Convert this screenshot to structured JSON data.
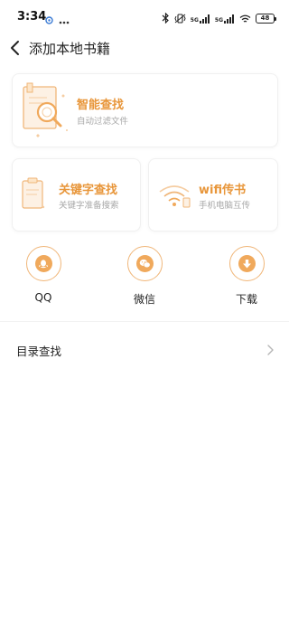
{
  "status_bar": {
    "time": "3:34",
    "network_1": "5G",
    "network_2": "5G",
    "battery": "48"
  },
  "header": {
    "title": "添加本地书籍"
  },
  "cards": {
    "smart": {
      "title": "智能查找",
      "subtitle": "自动过滤文件"
    },
    "keyword": {
      "title": "关键字查找",
      "subtitle": "关键字准备搜索"
    },
    "wifi": {
      "title": "wifi传书",
      "subtitle": "手机电脑互传"
    }
  },
  "sources": [
    {
      "label": "QQ",
      "icon": "qq-icon"
    },
    {
      "label": "微信",
      "icon": "wechat-icon"
    },
    {
      "label": "下载",
      "icon": "download-icon"
    }
  ],
  "directory": {
    "label": "目录查找"
  },
  "colors": {
    "accent": "#e8963a",
    "accent_light": "#f0a95c",
    "subtitle": "#a8a8a8"
  }
}
